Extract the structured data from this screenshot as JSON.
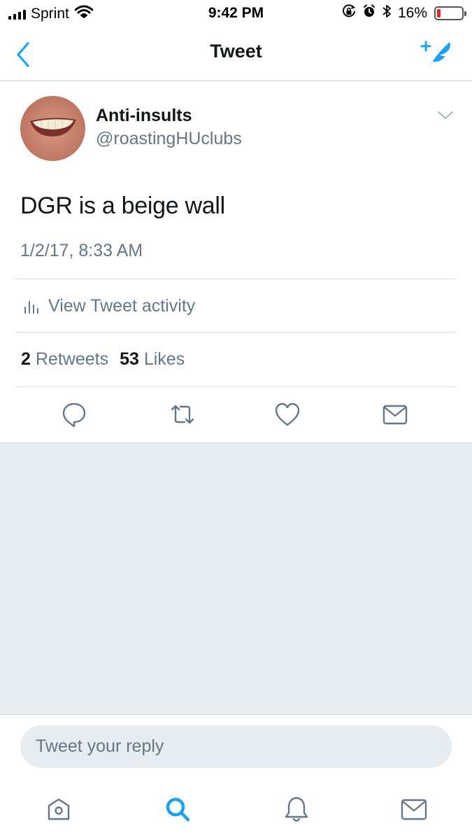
{
  "status_bar": {
    "carrier": "Sprint",
    "time": "9:42 PM",
    "battery_percent": "16%",
    "battery_level": 0.16,
    "battery_color": "#e0262a"
  },
  "nav": {
    "title": "Tweet",
    "back_icon": "chevron-left-icon",
    "compose_icon": "compose-tweet-icon"
  },
  "tweet": {
    "author_name": "Anti-insults",
    "author_handle": "@roastingHUclubs",
    "text": "DGR is a beige wall",
    "timestamp": "1/2/17, 8:33 AM",
    "activity_label": "View Tweet activity",
    "retweets_count": "2",
    "retweets_label": "Retweets",
    "likes_count": "53",
    "likes_label": "Likes"
  },
  "actions": [
    "reply-icon",
    "retweet-icon",
    "like-icon",
    "direct-message-icon"
  ],
  "reply": {
    "placeholder": "Tweet your reply"
  },
  "tab_bar": {
    "items": [
      "home-icon",
      "search-icon",
      "notifications-icon",
      "messages-icon"
    ],
    "active": "search-icon"
  },
  "colors": {
    "accent": "#1da1f2",
    "secondary_text": "#657786",
    "primary_text": "#14171a",
    "background_gray": "#e6ecf0"
  }
}
